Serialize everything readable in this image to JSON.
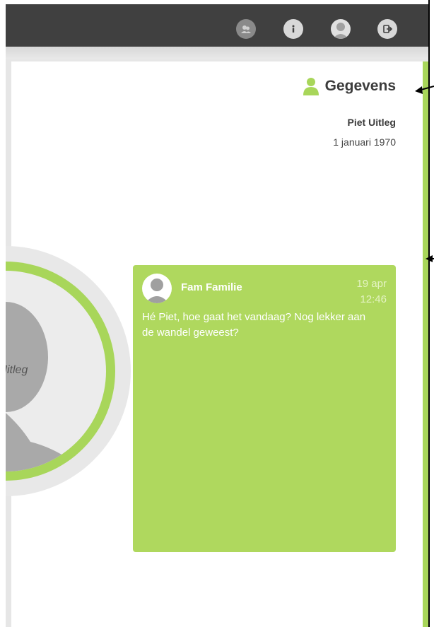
{
  "toolbar": {
    "icons": [
      "contacts-icon",
      "info-icon",
      "profile-icon",
      "logout-icon"
    ]
  },
  "details": {
    "title": "Gegevens",
    "name": "Piet Uitleg",
    "birthdate": "1 januari 1970"
  },
  "photo": {
    "name_fragment": "Jitleg"
  },
  "message": {
    "author": "Fam Familie",
    "date": "19 apr",
    "time": "12:46",
    "text": "Hé Piet, hoe gaat het vandaag? Nog lekker aan de wandel geweest?"
  },
  "colors": {
    "topbar": "#404040",
    "accent": "#a8d65a",
    "card": "#afd85e"
  }
}
